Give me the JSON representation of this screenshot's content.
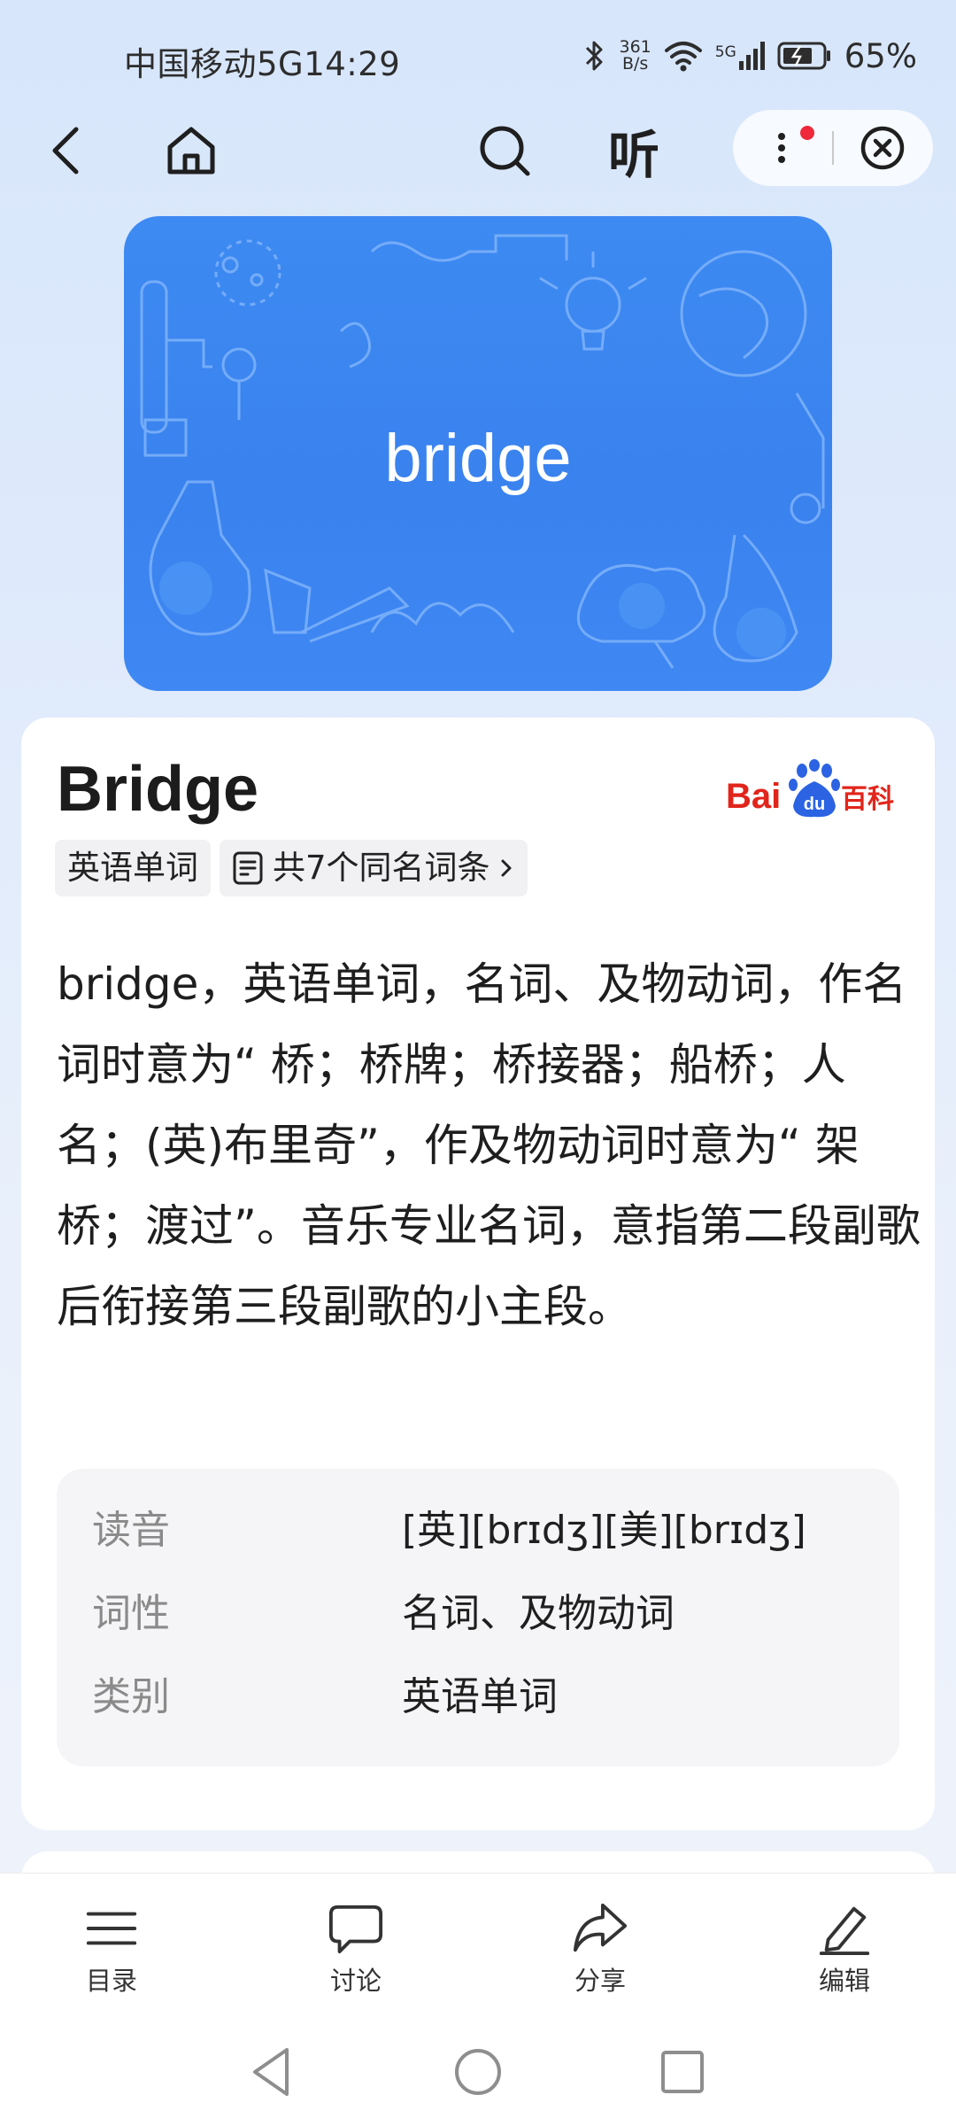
{
  "status_bar": {
    "carrier": "中国移动5G",
    "time": "14:29",
    "net_speed_value": "361",
    "net_speed_unit": "B/s",
    "signal_label": "5G",
    "battery": "65%",
    "icons": [
      "bluetooth-icon",
      "wifi-icon",
      "signal-icon",
      "battery-icon"
    ]
  },
  "top_nav": {
    "back_icon": "back-arrow-icon",
    "home_icon": "home-icon",
    "search_icon": "search-icon",
    "listen_label": "听",
    "more_icon": "more-vertical-icon",
    "close_icon": "close-circle-icon"
  },
  "banner": {
    "word": "bridge"
  },
  "entry": {
    "title": "Bridge",
    "source_logo": {
      "text_left": "Bai",
      "text_mid": "du",
      "text_right": "百科"
    },
    "tags": [
      "英语单词",
      "共7个同名词条"
    ],
    "description": "bridge，英语单词，名词、及物动词，作名词时意为“ 桥；桥牌；桥接器；船桥；人名；(英)布里奇”，作及物动词时意为“ 架桥；渡过”。音乐专业名词，意指第二段副歌后衔接第三段副歌的小主段。",
    "info": [
      {
        "label": "读音",
        "value": "[英][brɪdʒ][美][brɪdʒ]"
      },
      {
        "label": "词性",
        "value": "名词、及物动词"
      },
      {
        "label": "类别",
        "value": "英语单词"
      }
    ]
  },
  "toolbar": {
    "items": [
      {
        "label": "目录",
        "icon": "catalog-icon"
      },
      {
        "label": "讨论",
        "icon": "discussion-icon"
      },
      {
        "label": "分享",
        "icon": "share-icon"
      },
      {
        "label": "编辑",
        "icon": "edit-icon"
      }
    ]
  },
  "system_nav": {
    "icons": [
      "nav-back-icon",
      "nav-home-icon",
      "nav-recents-icon"
    ]
  },
  "colors": {
    "accent": "#3a84f0",
    "baike_red": "#e1251b",
    "baike_blue": "#2b63e3",
    "red_dot": "#f0283c"
  }
}
